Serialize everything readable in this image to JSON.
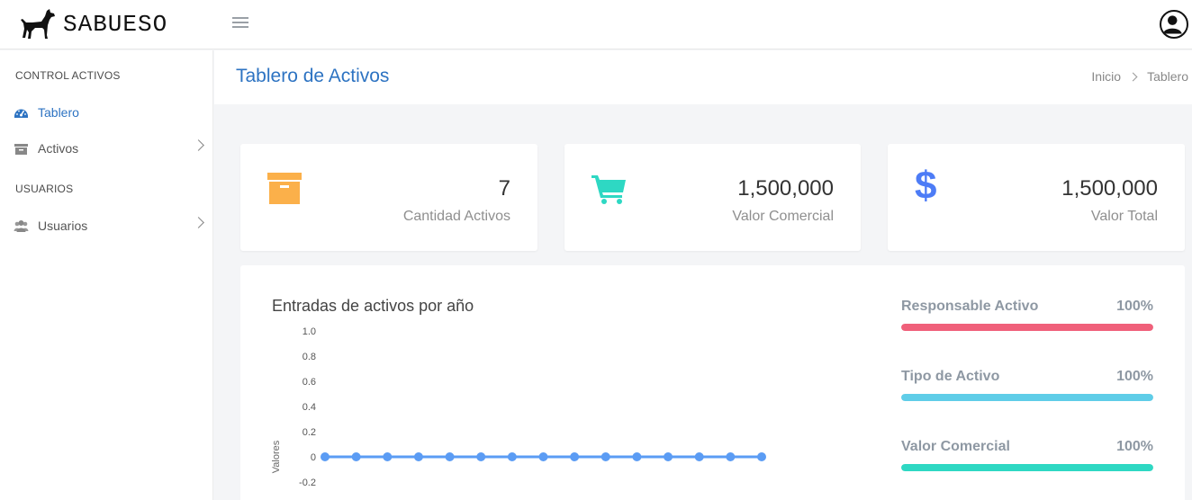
{
  "header": {
    "brand": "SABUESO"
  },
  "sidebar": {
    "sections": [
      {
        "heading": "CONTROL ACTIVOS"
      },
      {
        "heading": "USUARIOS"
      }
    ],
    "items": [
      {
        "label": "Tablero",
        "icon": "tachometer-icon"
      },
      {
        "label": "Activos",
        "icon": "archive-icon"
      },
      {
        "label": "Usuarios",
        "icon": "users-icon"
      }
    ]
  },
  "page": {
    "title": "Tablero de Activos",
    "breadcrumb": [
      "Inicio",
      "Tablero"
    ]
  },
  "stats": [
    {
      "value": "7",
      "caption": "Cantidad Activos",
      "icon": "archive-icon",
      "color": "#fbb04a"
    },
    {
      "value": "1,500,000",
      "caption": "Valor Comercial",
      "icon": "cart-icon",
      "color": "#2ed8c3"
    },
    {
      "value": "1,500,000",
      "caption": "Valor Total",
      "icon": "dollar-icon",
      "color": "#4d7cf6"
    }
  ],
  "chart": {
    "title": "Entradas de activos por año"
  },
  "chart_data": {
    "type": "line",
    "title": "Entradas de activos por año",
    "ylabel": "Valores",
    "xlabel": "",
    "ylim": [
      -0.2,
      1.0
    ],
    "yticks": [
      "1.0",
      "0.8",
      "0.6",
      "0.4",
      "0.2",
      "0",
      "-0.2"
    ],
    "series": [
      {
        "values": [
          0,
          0,
          0,
          0,
          0,
          0,
          0,
          0,
          0,
          0,
          0,
          0,
          0,
          0,
          0
        ],
        "color": "#5b9cf4"
      }
    ]
  },
  "progress": [
    {
      "label": "Responsable Activo",
      "value": "100%",
      "fraction": 1.0,
      "color": "#f0607a"
    },
    {
      "label": "Tipo de Activo",
      "value": "100%",
      "fraction": 1.0,
      "color": "#5fcde8"
    },
    {
      "label": "Valor Comercial",
      "value": "100%",
      "fraction": 1.0,
      "color": "#2ed8c3"
    }
  ]
}
